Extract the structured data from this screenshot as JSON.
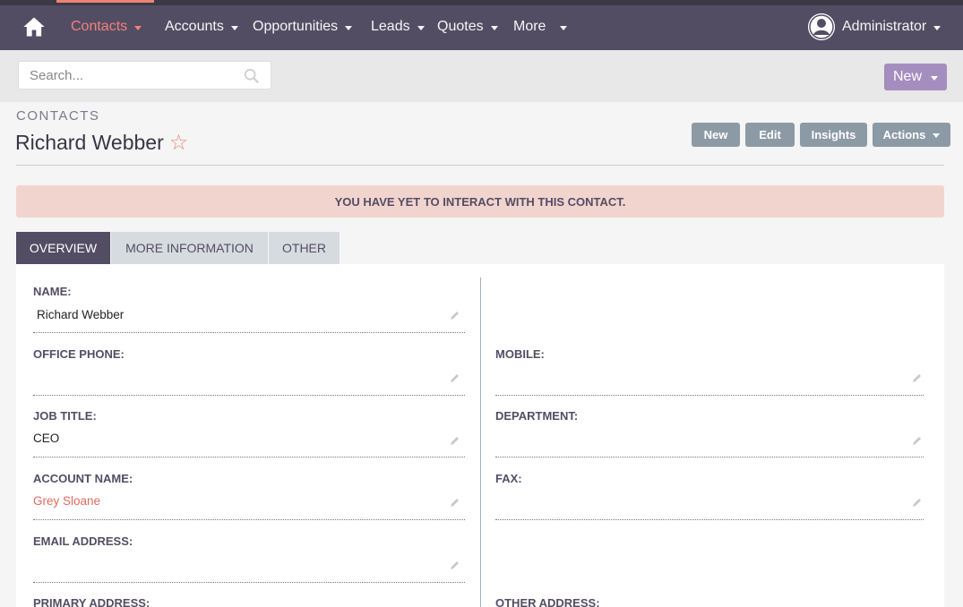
{
  "nav": {
    "items": [
      {
        "label": "Contacts"
      },
      {
        "label": "Accounts"
      },
      {
        "label": "Opportunities"
      },
      {
        "label": "Leads"
      },
      {
        "label": "Quotes"
      },
      {
        "label": "More"
      }
    ],
    "user": "Administrator"
  },
  "search": {
    "placeholder": "Search..."
  },
  "new_button": "New",
  "header": {
    "module": "CONTACTS",
    "record_name": "Richard Webber",
    "actions": {
      "new": "New",
      "edit": "Edit",
      "insights": "Insights",
      "actions": "Actions"
    }
  },
  "alert": "YOU HAVE YET TO INTERACT WITH THIS CONTACT.",
  "tabs": [
    "OVERVIEW",
    "MORE INFORMATION",
    "OTHER"
  ],
  "fields": {
    "name": {
      "label": "NAME:",
      "value": "Richard Webber"
    },
    "office_phone": {
      "label": "OFFICE PHONE:",
      "value": ""
    },
    "mobile": {
      "label": "MOBILE:",
      "value": ""
    },
    "job_title": {
      "label": "JOB TITLE:",
      "value": "CEO"
    },
    "department": {
      "label": "DEPARTMENT:",
      "value": ""
    },
    "account_name": {
      "label": "ACCOUNT NAME:",
      "value": "Grey Sloane"
    },
    "fax": {
      "label": "FAX:",
      "value": ""
    },
    "email": {
      "label": "EMAIL ADDRESS:",
      "value": ""
    },
    "primary_address": {
      "label": "PRIMARY ADDRESS:",
      "value": ""
    },
    "other_address": {
      "label": "OTHER ADDRESS:",
      "value": ""
    }
  },
  "colors": {
    "nav_bg": "#534d64",
    "accent": "#f08377",
    "new_button": "#a48dbf",
    "action_button": "#8c9aa6",
    "alert_bg": "#f2d4cf"
  }
}
